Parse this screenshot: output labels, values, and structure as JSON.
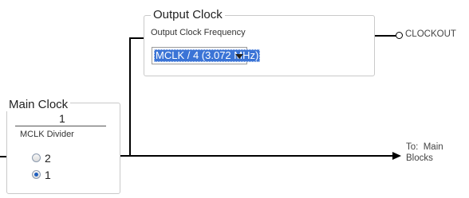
{
  "main_clock": {
    "title": "Main Clock",
    "numerator": "1",
    "divider_label": "MCLK Divider",
    "options": [
      {
        "label": "2",
        "selected": false
      },
      {
        "label": "1",
        "selected": true
      }
    ]
  },
  "output_clock": {
    "title": "Output Clock",
    "frequency_label": "Output Clock Frequency",
    "selected_value": "MCLK / 4 (3.072 MHz)"
  },
  "outputs": {
    "clockout_label": "CLOCKOUT",
    "to_main_line1": "To:  Main",
    "to_main_line2": "Blocks"
  },
  "colors": {
    "selection_highlight": "#3b74d6",
    "group_border": "#c9c9c9"
  }
}
